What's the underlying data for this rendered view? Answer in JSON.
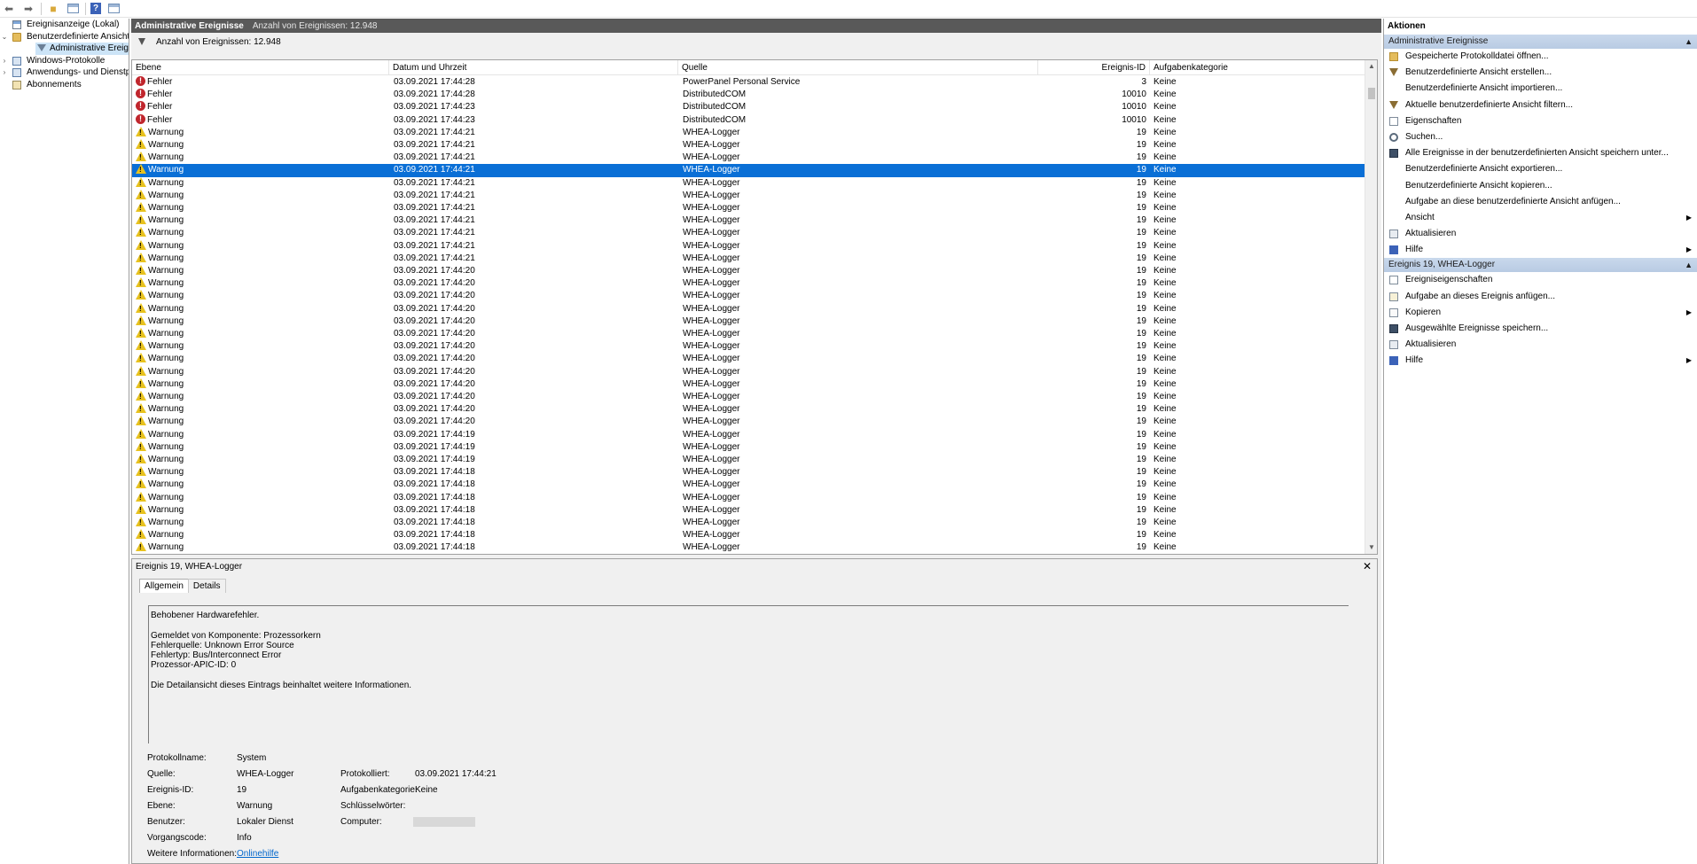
{
  "tree": {
    "items": [
      {
        "label": "Ereignisanzeige (Lokal)",
        "expander": "",
        "icon": "mmc"
      },
      {
        "label": "Benutzerdefinierte Ansichten",
        "expander": "⌄",
        "icon": "folder"
      },
      {
        "label": "Administrative Ereignisse",
        "expander": "",
        "icon": "filter",
        "selected": true
      },
      {
        "label": "Windows-Protokolle",
        "expander": "›",
        "icon": "logs"
      },
      {
        "label": "Anwendungs- und Dienstprotokolle",
        "expander": "›",
        "icon": "logs"
      },
      {
        "label": "Abonnements",
        "expander": "",
        "icon": "sub"
      }
    ]
  },
  "center": {
    "title": "Administrative Ereignisse",
    "count_title": "Anzahl von Ereignissen: 12.948",
    "filter_count": "Anzahl von Ereignissen: 12.948"
  },
  "grid": {
    "columns": [
      "Ebene",
      "Datum und Uhrzeit",
      "Quelle",
      "Ereignis-ID",
      "Aufgabenkategorie"
    ],
    "selected_index": 7,
    "rows": [
      {
        "level": "Fehler",
        "icon": "error",
        "date": "03.09.2021 17:44:28",
        "source": "PowerPanel Personal Service",
        "id": "3",
        "category": "Keine"
      },
      {
        "level": "Fehler",
        "icon": "error",
        "date": "03.09.2021 17:44:28",
        "source": "DistributedCOM",
        "id": "10010",
        "category": "Keine"
      },
      {
        "level": "Fehler",
        "icon": "error",
        "date": "03.09.2021 17:44:23",
        "source": "DistributedCOM",
        "id": "10010",
        "category": "Keine"
      },
      {
        "level": "Fehler",
        "icon": "error",
        "date": "03.09.2021 17:44:23",
        "source": "DistributedCOM",
        "id": "10010",
        "category": "Keine"
      },
      {
        "level": "Warnung",
        "icon": "warn",
        "date": "03.09.2021 17:44:21",
        "source": "WHEA-Logger",
        "id": "19",
        "category": "Keine"
      },
      {
        "level": "Warnung",
        "icon": "warn",
        "date": "03.09.2021 17:44:21",
        "source": "WHEA-Logger",
        "id": "19",
        "category": "Keine"
      },
      {
        "level": "Warnung",
        "icon": "warn",
        "date": "03.09.2021 17:44:21",
        "source": "WHEA-Logger",
        "id": "19",
        "category": "Keine"
      },
      {
        "level": "Warnung",
        "icon": "warn",
        "date": "03.09.2021 17:44:21",
        "source": "WHEA-Logger",
        "id": "19",
        "category": "Keine"
      },
      {
        "level": "Warnung",
        "icon": "warn",
        "date": "03.09.2021 17:44:21",
        "source": "WHEA-Logger",
        "id": "19",
        "category": "Keine"
      },
      {
        "level": "Warnung",
        "icon": "warn",
        "date": "03.09.2021 17:44:21",
        "source": "WHEA-Logger",
        "id": "19",
        "category": "Keine"
      },
      {
        "level": "Warnung",
        "icon": "warn",
        "date": "03.09.2021 17:44:21",
        "source": "WHEA-Logger",
        "id": "19",
        "category": "Keine"
      },
      {
        "level": "Warnung",
        "icon": "warn",
        "date": "03.09.2021 17:44:21",
        "source": "WHEA-Logger",
        "id": "19",
        "category": "Keine"
      },
      {
        "level": "Warnung",
        "icon": "warn",
        "date": "03.09.2021 17:44:21",
        "source": "WHEA-Logger",
        "id": "19",
        "category": "Keine"
      },
      {
        "level": "Warnung",
        "icon": "warn",
        "date": "03.09.2021 17:44:21",
        "source": "WHEA-Logger",
        "id": "19",
        "category": "Keine"
      },
      {
        "level": "Warnung",
        "icon": "warn",
        "date": "03.09.2021 17:44:21",
        "source": "WHEA-Logger",
        "id": "19",
        "category": "Keine"
      },
      {
        "level": "Warnung",
        "icon": "warn",
        "date": "03.09.2021 17:44:20",
        "source": "WHEA-Logger",
        "id": "19",
        "category": "Keine"
      },
      {
        "level": "Warnung",
        "icon": "warn",
        "date": "03.09.2021 17:44:20",
        "source": "WHEA-Logger",
        "id": "19",
        "category": "Keine"
      },
      {
        "level": "Warnung",
        "icon": "warn",
        "date": "03.09.2021 17:44:20",
        "source": "WHEA-Logger",
        "id": "19",
        "category": "Keine"
      },
      {
        "level": "Warnung",
        "icon": "warn",
        "date": "03.09.2021 17:44:20",
        "source": "WHEA-Logger",
        "id": "19",
        "category": "Keine"
      },
      {
        "level": "Warnung",
        "icon": "warn",
        "date": "03.09.2021 17:44:20",
        "source": "WHEA-Logger",
        "id": "19",
        "category": "Keine"
      },
      {
        "level": "Warnung",
        "icon": "warn",
        "date": "03.09.2021 17:44:20",
        "source": "WHEA-Logger",
        "id": "19",
        "category": "Keine"
      },
      {
        "level": "Warnung",
        "icon": "warn",
        "date": "03.09.2021 17:44:20",
        "source": "WHEA-Logger",
        "id": "19",
        "category": "Keine"
      },
      {
        "level": "Warnung",
        "icon": "warn",
        "date": "03.09.2021 17:44:20",
        "source": "WHEA-Logger",
        "id": "19",
        "category": "Keine"
      },
      {
        "level": "Warnung",
        "icon": "warn",
        "date": "03.09.2021 17:44:20",
        "source": "WHEA-Logger",
        "id": "19",
        "category": "Keine"
      },
      {
        "level": "Warnung",
        "icon": "warn",
        "date": "03.09.2021 17:44:20",
        "source": "WHEA-Logger",
        "id": "19",
        "category": "Keine"
      },
      {
        "level": "Warnung",
        "icon": "warn",
        "date": "03.09.2021 17:44:20",
        "source": "WHEA-Logger",
        "id": "19",
        "category": "Keine"
      },
      {
        "level": "Warnung",
        "icon": "warn",
        "date": "03.09.2021 17:44:20",
        "source": "WHEA-Logger",
        "id": "19",
        "category": "Keine"
      },
      {
        "level": "Warnung",
        "icon": "warn",
        "date": "03.09.2021 17:44:20",
        "source": "WHEA-Logger",
        "id": "19",
        "category": "Keine"
      },
      {
        "level": "Warnung",
        "icon": "warn",
        "date": "03.09.2021 17:44:19",
        "source": "WHEA-Logger",
        "id": "19",
        "category": "Keine"
      },
      {
        "level": "Warnung",
        "icon": "warn",
        "date": "03.09.2021 17:44:19",
        "source": "WHEA-Logger",
        "id": "19",
        "category": "Keine"
      },
      {
        "level": "Warnung",
        "icon": "warn",
        "date": "03.09.2021 17:44:19",
        "source": "WHEA-Logger",
        "id": "19",
        "category": "Keine"
      },
      {
        "level": "Warnung",
        "icon": "warn",
        "date": "03.09.2021 17:44:18",
        "source": "WHEA-Logger",
        "id": "19",
        "category": "Keine"
      },
      {
        "level": "Warnung",
        "icon": "warn",
        "date": "03.09.2021 17:44:18",
        "source": "WHEA-Logger",
        "id": "19",
        "category": "Keine"
      },
      {
        "level": "Warnung",
        "icon": "warn",
        "date": "03.09.2021 17:44:18",
        "source": "WHEA-Logger",
        "id": "19",
        "category": "Keine"
      },
      {
        "level": "Warnung",
        "icon": "warn",
        "date": "03.09.2021 17:44:18",
        "source": "WHEA-Logger",
        "id": "19",
        "category": "Keine"
      },
      {
        "level": "Warnung",
        "icon": "warn",
        "date": "03.09.2021 17:44:18",
        "source": "WHEA-Logger",
        "id": "19",
        "category": "Keine"
      },
      {
        "level": "Warnung",
        "icon": "warn",
        "date": "03.09.2021 17:44:18",
        "source": "WHEA-Logger",
        "id": "19",
        "category": "Keine"
      },
      {
        "level": "Warnung",
        "icon": "warn",
        "date": "03.09.2021 17:44:18",
        "source": "WHEA-Logger",
        "id": "19",
        "category": "Keine"
      }
    ]
  },
  "preview": {
    "title": "Ereignis 19, WHEA-Logger",
    "close": "✕",
    "tabs": [
      "Allgemein",
      "Details"
    ],
    "description_lines": [
      "Behobener Hardwarefehler.",
      "",
      "Gemeldet von Komponente: Prozessorkern",
      "Fehlerquelle: Unknown Error Source",
      "Fehlertyp: Bus/Interconnect Error",
      "Prozessor-APIC-ID: 0",
      "",
      "Die Detailansicht dieses Eintrags beinhaltet weitere Informationen."
    ],
    "props": {
      "log_name_label": "Protokollname:",
      "log_name": "System",
      "source_label": "Quelle:",
      "source": "WHEA-Logger",
      "logged_label": "Protokolliert:",
      "logged": "03.09.2021 17:44:21",
      "event_id_label": "Ereignis-ID:",
      "event_id": "19",
      "task_cat_label": "Aufgabenkategorie:",
      "task_cat": "Keine",
      "level_label": "Ebene:",
      "level": "Warnung",
      "keywords_label": "Schlüsselwörter:",
      "keywords": "",
      "user_label": "Benutzer:",
      "user": "Lokaler Dienst",
      "computer_label": "Computer:",
      "opcode_label": "Vorgangscode:",
      "opcode": "Info",
      "more_info_label": "Weitere Informationen:",
      "more_info_link": "Onlinehilfe"
    }
  },
  "actions": {
    "title": "Aktionen",
    "groups": [
      {
        "title": "Administrative Ereignisse",
        "items": [
          {
            "label": "Gespeicherte Protokolldatei öffnen...",
            "icon": "open"
          },
          {
            "label": "Benutzerdefinierte Ansicht erstellen...",
            "icon": "filter"
          },
          {
            "label": "Benutzerdefinierte Ansicht importieren...",
            "icon": ""
          },
          {
            "label": "Aktuelle benutzerdefinierte Ansicht filtern...",
            "icon": "filter"
          },
          {
            "label": "Eigenschaften",
            "icon": "props"
          },
          {
            "label": "Suchen...",
            "icon": "find"
          },
          {
            "label": "Alle Ereignisse in der benutzerdefinierten Ansicht speichern unter...",
            "icon": "save"
          },
          {
            "label": "Benutzerdefinierte Ansicht exportieren...",
            "icon": ""
          },
          {
            "label": "Benutzerdefinierte Ansicht kopieren...",
            "icon": ""
          },
          {
            "label": "Aufgabe an diese benutzerdefinierte Ansicht anfügen...",
            "icon": ""
          },
          {
            "label": "Ansicht",
            "icon": "",
            "submenu": true
          },
          {
            "label": "Aktualisieren",
            "icon": "refresh"
          },
          {
            "label": "Hilfe",
            "icon": "help",
            "submenu": true
          }
        ]
      },
      {
        "title": "Ereignis 19, WHEA-Logger",
        "items": [
          {
            "label": "Ereigniseigenschaften",
            "icon": "props"
          },
          {
            "label": "Aufgabe an dieses Ereignis anfügen...",
            "icon": "task"
          },
          {
            "label": "Kopieren",
            "icon": "copy",
            "submenu": true
          },
          {
            "label": "Ausgewählte Ereignisse speichern...",
            "icon": "save"
          },
          {
            "label": "Aktualisieren",
            "icon": "refresh"
          },
          {
            "label": "Hilfe",
            "icon": "help",
            "submenu": true
          }
        ]
      }
    ]
  },
  "colors": {
    "selection": "#0a6fd6",
    "title_bar": "#595959",
    "group_header": "#c9d8ec",
    "error": "#c0262d",
    "warning": "#e8c21e",
    "link": "#0066cc"
  },
  "icons": {
    "back": "back-arrow-icon",
    "forward": "forward-arrow-icon",
    "collapse": "chevron-up-icon",
    "submenu": "chevron-right-icon"
  }
}
